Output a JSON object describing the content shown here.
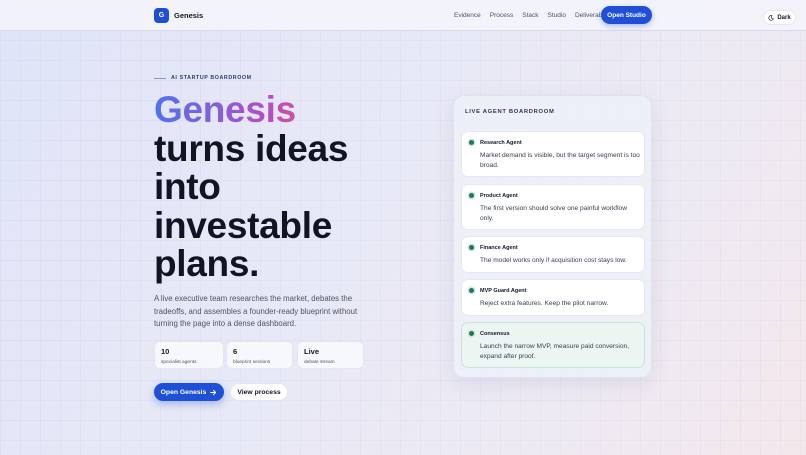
{
  "brand": {
    "mark": "G",
    "name": "Genesis"
  },
  "nav": {
    "links": [
      "Evidence",
      "Process",
      "Stack",
      "Studio",
      "Deliverables"
    ],
    "cta": "Open Studio",
    "theme_toggle": "Dark"
  },
  "hero": {
    "eyebrow": "AI STARTUP BOARDROOM",
    "title_highlight": "Genesis",
    "title_lines": [
      "turns ideas",
      "into",
      "investable",
      "plans."
    ],
    "description": "A live executive team researches the market, debates the tradeoffs, and assembles a founder-ready blueprint without turning the page into a dense dashboard.",
    "stats": [
      {
        "value": "10",
        "label": "specialist agents"
      },
      {
        "value": "6",
        "label": "blueprint sections"
      },
      {
        "value": "Live",
        "label": "debate stream"
      }
    ],
    "primary_cta": "Open Genesis",
    "secondary_cta": "View process"
  },
  "boardroom": {
    "title": "LIVE AGENT BOARDROOM",
    "agents": [
      {
        "name": "Research Agent",
        "message": "Market demand is visible, but the target segment is too broad."
      },
      {
        "name": "Product Agent",
        "message": "The first version should solve one painful workflow only."
      },
      {
        "name": "Finance Agent",
        "message": "The model works only if acquisition cost stays low."
      },
      {
        "name": "MVP Guard Agent",
        "message": "Reject extra features. Keep the pilot narrow."
      },
      {
        "name": "Consensus",
        "message": "Launch the narrow MVP, measure paid conversion, expand after proof."
      }
    ]
  },
  "colors": {
    "accent": "#1f4fd6",
    "status_dot": "#1f7a55"
  }
}
